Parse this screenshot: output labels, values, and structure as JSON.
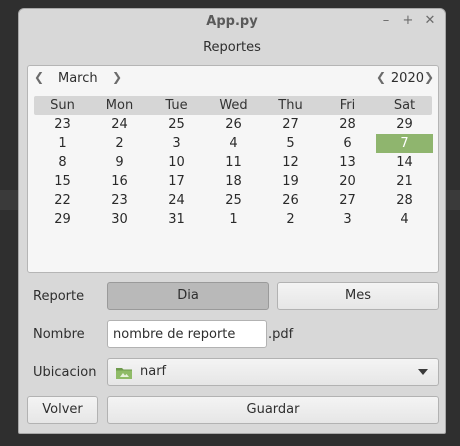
{
  "window": {
    "title": "App.py"
  },
  "subtitle": "Reportes",
  "calendar": {
    "month": "March",
    "year": "2020",
    "weekdays": [
      "Sun",
      "Mon",
      "Tue",
      "Wed",
      "Thu",
      "Fri",
      "Sat"
    ],
    "weeks": [
      [
        "23",
        "24",
        "25",
        "26",
        "27",
        "28",
        "29"
      ],
      [
        "1",
        "2",
        "3",
        "4",
        "5",
        "6",
        "7"
      ],
      [
        "8",
        "9",
        "10",
        "11",
        "12",
        "13",
        "14"
      ],
      [
        "15",
        "16",
        "17",
        "18",
        "19",
        "20",
        "21"
      ],
      [
        "22",
        "23",
        "24",
        "25",
        "26",
        "27",
        "28"
      ],
      [
        "29",
        "30",
        "31",
        "1",
        "2",
        "3",
        "4"
      ]
    ],
    "selected_day": "7",
    "selected_color": "#8fb56e"
  },
  "report": {
    "label": "Reporte",
    "options": [
      "Dia",
      "Mes"
    ],
    "active": "Dia"
  },
  "name": {
    "label": "Nombre",
    "value": "nombre de reporte",
    "suffix": ".pdf"
  },
  "location": {
    "label": "Ubicacion",
    "value": "narf",
    "icon": "folder-icon"
  },
  "actions": {
    "back_label": "Volver",
    "save_label": "Guardar"
  }
}
